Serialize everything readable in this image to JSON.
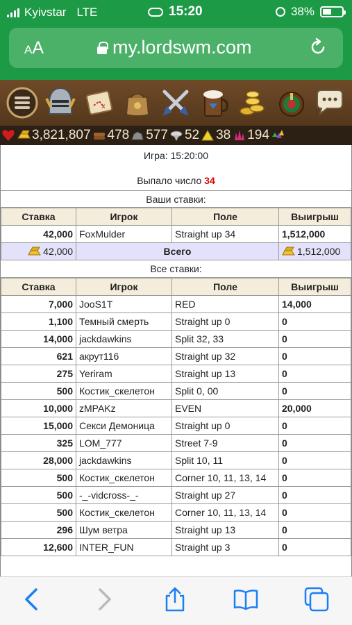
{
  "status_bar": {
    "carrier": "Kyivstar",
    "network": "LTE",
    "time": "15:20",
    "battery": "38%"
  },
  "browser": {
    "text_size": "aA",
    "url": "my.lordswm.com"
  },
  "nav_icons": [
    "menu-icon",
    "knight-helmet-icon",
    "map-scroll-icon",
    "inventory-bag-icon",
    "crossed-swords-icon",
    "tavern-mug-icon",
    "gold-coins-icon",
    "roulette-icon",
    "chat-bubbles-icon"
  ],
  "resources": {
    "gold": "3,821,807",
    "wood": "478",
    "ore": "577",
    "mercury": "52",
    "sulfur": "38",
    "crystals": "194"
  },
  "game": {
    "time": "Игра: 15:20:00",
    "result_label": "Выпало число",
    "result_number": "34",
    "your_bets_label": "Ваши ставки:",
    "all_bets_label": "Все ставки:",
    "headers": {
      "bet": "Ставка",
      "player": "Игрок",
      "field": "Поле",
      "win": "Выигрыш"
    },
    "your_bets": [
      {
        "bet": "42,000",
        "player": "FoxMulder",
        "field": "Straight up 34",
        "win": "1,512,000"
      }
    ],
    "total": {
      "label": "Всего",
      "bet": "42,000",
      "win": "1,512,000"
    },
    "all_bets": [
      {
        "bet": "7,000",
        "player": "JooS1T",
        "field": "RED",
        "win": "14,000"
      },
      {
        "bet": "1,100",
        "player": "Темный смерть",
        "field": "Straight up 0",
        "win": "0"
      },
      {
        "bet": "14,000",
        "player": "jackdawkins",
        "field": "Split 32, 33",
        "win": "0"
      },
      {
        "bet": "621",
        "player": "акрут116",
        "field": "Straight up 32",
        "win": "0"
      },
      {
        "bet": "275",
        "player": "Yeriram",
        "field": "Straight up 13",
        "win": "0"
      },
      {
        "bet": "500",
        "player": "Костик_скелетон",
        "field": "Split 0, 00",
        "win": "0"
      },
      {
        "bet": "10,000",
        "player": "zMPAKz",
        "field": "EVEN",
        "win": "20,000"
      },
      {
        "bet": "15,000",
        "player": "Секси Демоница",
        "field": "Straight up 0",
        "win": "0"
      },
      {
        "bet": "325",
        "player": "LOM_777",
        "field": "Street 7-9",
        "win": "0"
      },
      {
        "bet": "28,000",
        "player": "jackdawkins",
        "field": "Split 10, 11",
        "win": "0"
      },
      {
        "bet": "500",
        "player": "Костик_скелетон",
        "field": "Corner 10, 11, 13, 14",
        "win": "0"
      },
      {
        "bet": "500",
        "player": "-_-vidcross-_-",
        "field": "Straight up 27",
        "win": "0"
      },
      {
        "bet": "500",
        "player": "Костик_скелетон",
        "field": "Corner 10, 11, 13, 14",
        "win": "0"
      },
      {
        "bet": "296",
        "player": "Шум ветра",
        "field": "Straight up 13",
        "win": "0"
      },
      {
        "bet": "12,600",
        "player": "INTER_FUN",
        "field": "Straight up 3",
        "win": "0"
      }
    ]
  },
  "toolbar": [
    "back-icon",
    "forward-icon",
    "share-icon",
    "bookmarks-icon",
    "tabs-icon"
  ]
}
